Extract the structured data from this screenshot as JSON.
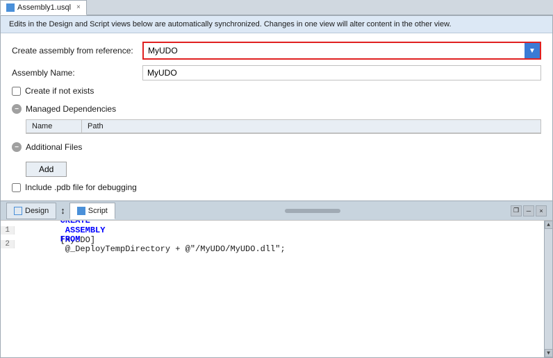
{
  "tab": {
    "label": "Assembly1.usql",
    "icon": "file-icon",
    "close_icon": "×"
  },
  "info_bar": {
    "text": "Edits in the Design and Script views below are automatically synchronized. Changes in one view will alter content in the other view."
  },
  "form": {
    "create_assembly_label": "Create assembly from reference:",
    "create_assembly_value": "MyUDO",
    "assembly_name_label": "Assembly Name:",
    "assembly_name_value": "MyUDO",
    "create_if_not_exists_label": "Create if not exists",
    "managed_dependencies_label": "Managed Dependencies",
    "managed_dep_col1": "Name",
    "managed_dep_col2": "Path",
    "additional_files_label": "Additional Files",
    "add_button_label": "Add",
    "include_pdb_label": "Include .pdb file for debugging"
  },
  "bottom_tabs": {
    "design_label": "Design",
    "design_icon": "grid-icon",
    "arrows_icon": "↕",
    "script_label": "Script",
    "script_icon": "code-icon"
  },
  "window_controls": {
    "restore": "❐",
    "pin": "─",
    "close": "×"
  },
  "code": {
    "line1_keyword1": "CREATE",
    "line1_keyword2": "ASSEMBLY",
    "line1_ident": "[MyUDO]",
    "line2_keyword": "FROM",
    "line2_value": "@_DeployTempDirectory + @\"/MyUDO/MyUDO.dll\";"
  }
}
